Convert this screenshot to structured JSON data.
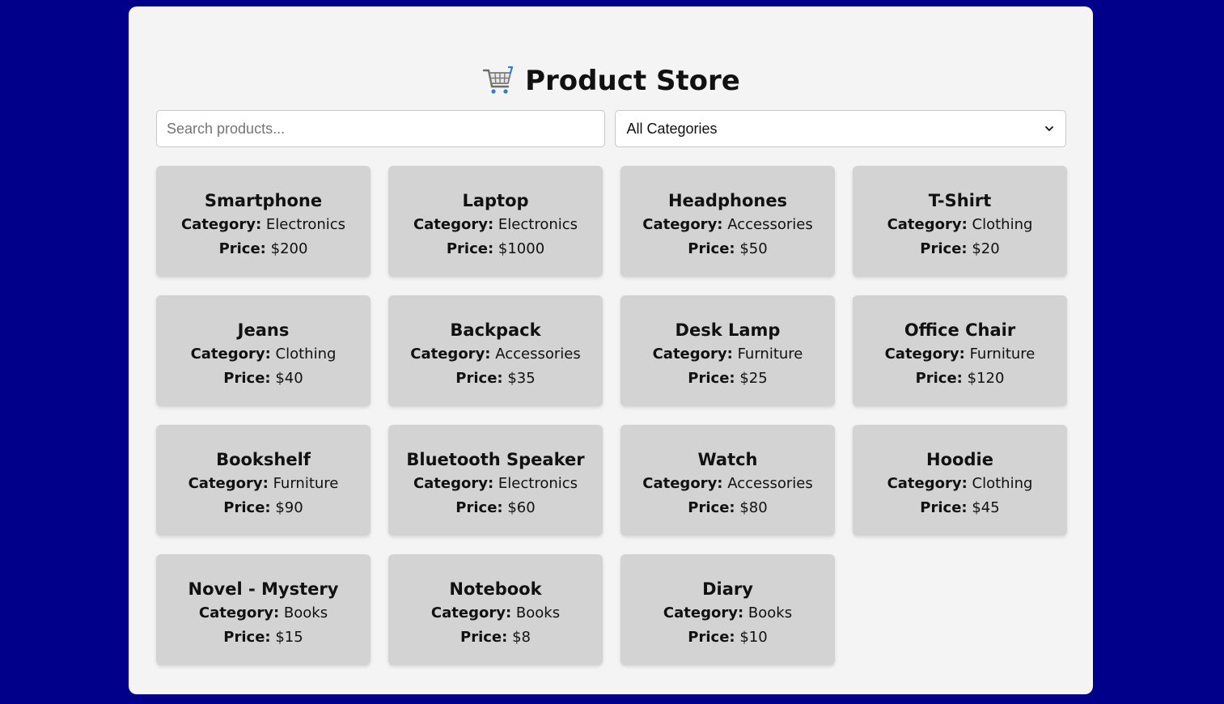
{
  "header": {
    "title": "Product Store",
    "icon": "shopping-cart-icon"
  },
  "controls": {
    "search_placeholder": "Search products...",
    "search_value": "",
    "category_selected": "All Categories"
  },
  "labels": {
    "category": "Category:",
    "price": "Price:"
  },
  "products": [
    {
      "name": "Smartphone",
      "category": "Electronics",
      "price": "$200"
    },
    {
      "name": "Laptop",
      "category": "Electronics",
      "price": "$1000"
    },
    {
      "name": "Headphones",
      "category": "Accessories",
      "price": "$50"
    },
    {
      "name": "T-Shirt",
      "category": "Clothing",
      "price": "$20"
    },
    {
      "name": "Jeans",
      "category": "Clothing",
      "price": "$40"
    },
    {
      "name": "Backpack",
      "category": "Accessories",
      "price": "$35"
    },
    {
      "name": "Desk Lamp",
      "category": "Furniture",
      "price": "$25"
    },
    {
      "name": "Office Chair",
      "category": "Furniture",
      "price": "$120"
    },
    {
      "name": "Bookshelf",
      "category": "Furniture",
      "price": "$90"
    },
    {
      "name": "Bluetooth Speaker",
      "category": "Electronics",
      "price": "$60"
    },
    {
      "name": "Watch",
      "category": "Accessories",
      "price": "$80"
    },
    {
      "name": "Hoodie",
      "category": "Clothing",
      "price": "$45"
    },
    {
      "name": "Novel - Mystery",
      "category": "Books",
      "price": "$15"
    },
    {
      "name": "Notebook",
      "category": "Books",
      "price": "$8"
    },
    {
      "name": "Diary",
      "category": "Books",
      "price": "$10"
    }
  ],
  "colors": {
    "background": "#00008b",
    "panel": "#f4f4f4",
    "card": "#d3d3d3"
  }
}
